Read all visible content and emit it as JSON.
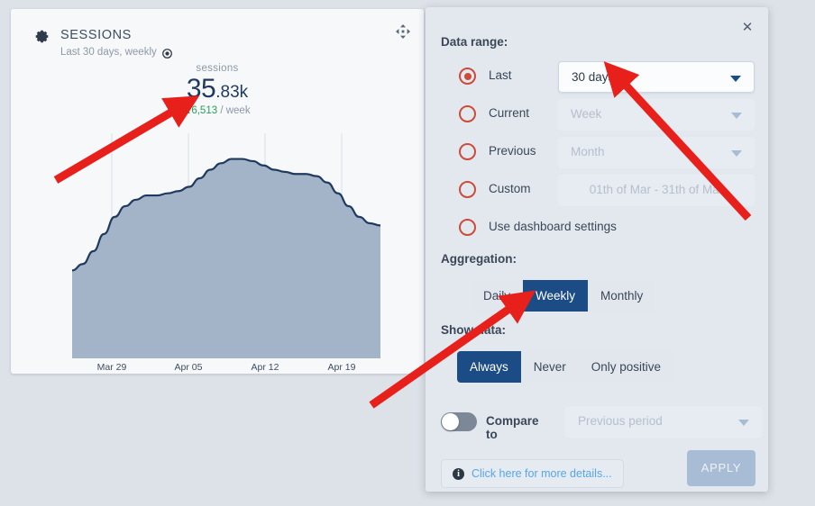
{
  "widget": {
    "gear_icon": "gear-icon",
    "move_icon": "move-handle-icon",
    "title": "SESSIONS",
    "subtitle": "Last 30 days, weekly",
    "subtitle_icon": "target-icon",
    "metric_caption": "sessions",
    "metric_integer": "35",
    "metric_fraction": ".83k",
    "delta_arrow": "▲",
    "delta_value": "6,513",
    "delta_unit": "/ week"
  },
  "chart_data": {
    "type": "area",
    "title": "sessions",
    "xlabel": "",
    "ylabel": "sessions",
    "grid": true,
    "legend": "none",
    "line_color": "#1f3a5f",
    "fill_color": "#a4b4c8",
    "x_tick_labels": [
      "Mar 29",
      "Apr 05",
      "Apr 12",
      "Apr 19"
    ],
    "x_tick_positions": [
      112,
      197,
      282,
      367
    ],
    "ylim": [
      0,
      100
    ],
    "x": [
      0,
      1,
      2,
      3,
      4,
      5,
      6,
      7,
      8,
      9,
      10,
      11,
      12,
      13,
      14,
      15,
      16,
      17,
      18,
      19,
      20,
      21,
      22,
      23,
      24,
      25,
      26,
      27,
      28,
      29
    ],
    "values": [
      41,
      44,
      50,
      58,
      66,
      71,
      74,
      76,
      76,
      77,
      78,
      80,
      84,
      88,
      91,
      93,
      93,
      92,
      90,
      88,
      87,
      86,
      86,
      85,
      82,
      77,
      71,
      66,
      63,
      62
    ]
  },
  "dialog": {
    "close_icon": "close-icon",
    "data_range_label": "Data range:",
    "aggregation_label": "Aggregation:",
    "show_data_label": "Show data:",
    "radio_options": [
      {
        "label": "Last",
        "checked": true,
        "field_value": "30 days",
        "field_enabled": true,
        "field_centered": false,
        "has_field": true
      },
      {
        "label": "Current",
        "checked": false,
        "field_value": "Week",
        "field_enabled": false,
        "field_centered": false,
        "has_field": true
      },
      {
        "label": "Previous",
        "checked": false,
        "field_value": "Month",
        "field_enabled": false,
        "field_centered": false,
        "has_field": true
      },
      {
        "label": "Custom",
        "checked": false,
        "field_value": "01th of Mar - 31th of Mar",
        "field_enabled": false,
        "field_centered": true,
        "has_field": true
      },
      {
        "label": "Use dashboard settings",
        "checked": false,
        "field_value": "",
        "field_enabled": false,
        "field_centered": false,
        "has_field": false
      }
    ],
    "aggregation_options": [
      {
        "label": "Daily",
        "active": false
      },
      {
        "label": "Weekly",
        "active": true
      },
      {
        "label": "Monthly",
        "active": false
      }
    ],
    "show_data_options": [
      {
        "label": "Always",
        "active": true
      },
      {
        "label": "Never",
        "active": false
      },
      {
        "label": "Only positive",
        "active": false
      }
    ],
    "compare": {
      "toggle_on": false,
      "label": "Compare to",
      "field_value": "Previous period"
    },
    "details_info_icon": "info-icon",
    "details_link": "Click here for more details...",
    "apply_label": "APPLY"
  },
  "colors": {
    "page_background": "#dde1e8",
    "card_background": "#f6f8fa",
    "dialog_background": "#e3e8ef",
    "accent_blue": "#1c4c86",
    "radio_red": "#cb4c3a",
    "delta_green": "#2aa05a",
    "link_blue": "#56a7e8",
    "annotation_red": "#e8201b",
    "apply_disabled": "#a9bcd6"
  }
}
